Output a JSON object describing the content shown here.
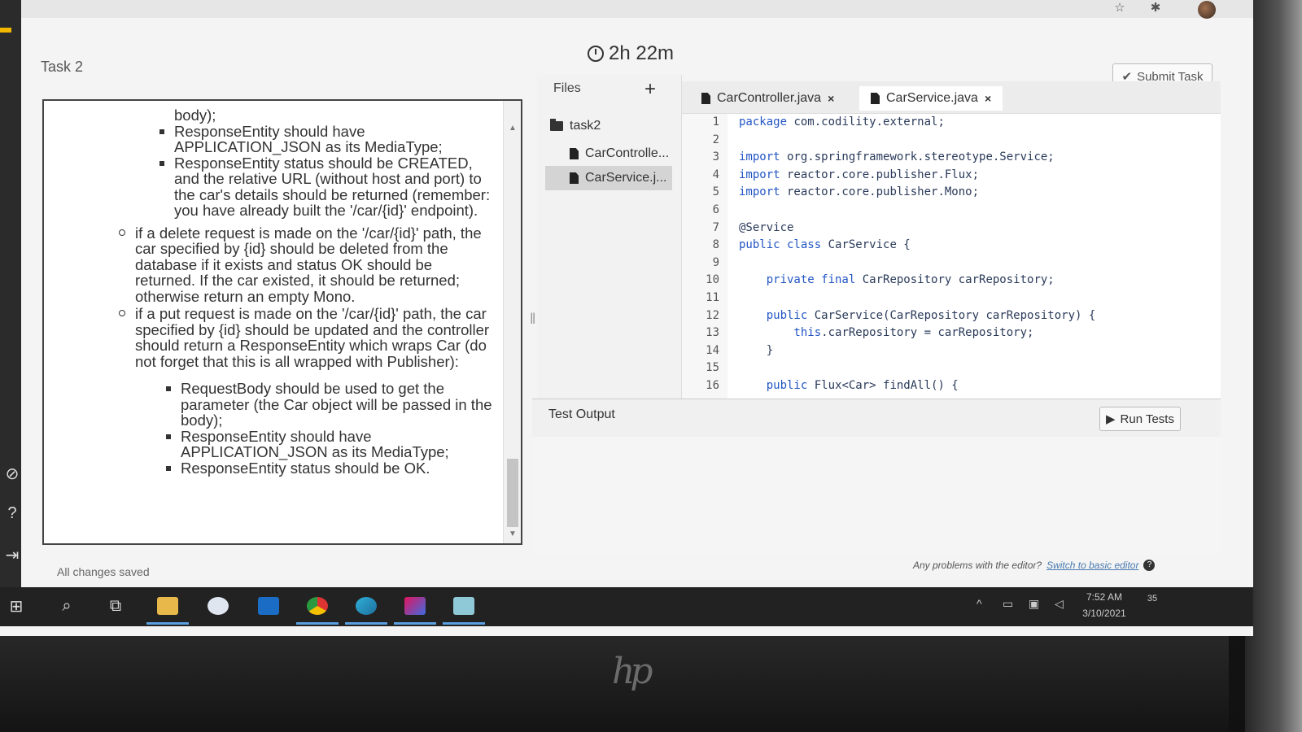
{
  "task_title": "Task 2",
  "timer": "2h 22m",
  "submit_label": "Submit Task",
  "instructions": {
    "cont_text": "body);",
    "group1_bullets": [
      "ResponseEntity should have APPLICATION_JSON as its MediaType;",
      "ResponseEntity status should be CREATED, and the relative URL (without host and port) to the car's details should be returned (remember: you have already built the '/car/{id}' endpoint)."
    ],
    "delete_item": "if a delete request is made on the '/car/{id}' path, the car specified by {id} should be deleted from the database if it exists and status OK should be returned. If the car existed, it should be returned; otherwise return an empty Mono.",
    "put_item": "if a put request is made on the '/car/{id}' path, the car specified by {id} should be updated and the controller should return a ResponseEntity which wraps Car (do not forget that this is all wrapped with Publisher):",
    "put_bullets": [
      "RequestBody should be used to get the parameter (the Car object will be passed in the body);",
      "ResponseEntity should have APPLICATION_JSON as its MediaType;",
      "ResponseEntity status should be OK."
    ]
  },
  "status": "All changes saved",
  "files": {
    "header": "Files",
    "add_symbol": "+",
    "folder": "task2",
    "items": [
      "CarControlle...",
      "CarService.j..."
    ],
    "selected_index": 1
  },
  "tabs": [
    {
      "label": "CarController.java",
      "active": false
    },
    {
      "label": "CarService.java",
      "active": true
    }
  ],
  "code_lines": [
    {
      "n": "1",
      "kw": "package",
      "rest": " com.codility.external;"
    },
    {
      "n": "2",
      "kw": "",
      "rest": ""
    },
    {
      "n": "3",
      "kw": "import",
      "rest": " org.springframework.stereotype.Service;"
    },
    {
      "n": "4",
      "kw": "import",
      "rest": " reactor.core.publisher.Flux;"
    },
    {
      "n": "5",
      "kw": "import",
      "rest": " reactor.core.publisher.Mono;"
    },
    {
      "n": "6",
      "kw": "",
      "rest": ""
    },
    {
      "n": "7",
      "kw": "",
      "rest": "@Service"
    },
    {
      "n": "8",
      "kw": "public class",
      "rest": " CarService {"
    },
    {
      "n": "9",
      "kw": "",
      "rest": ""
    },
    {
      "n": "10",
      "kw": "    private final",
      "rest": " CarRepository carRepository;"
    },
    {
      "n": "11",
      "kw": "",
      "rest": ""
    },
    {
      "n": "12",
      "kw": "    public",
      "rest": " CarService(CarRepository carRepository) {"
    },
    {
      "n": "13",
      "kw": "        this",
      "rest": ".carRepository = carRepository;"
    },
    {
      "n": "14",
      "kw": "",
      "rest": "    }"
    },
    {
      "n": "15",
      "kw": "",
      "rest": ""
    },
    {
      "n": "16",
      "kw": "    public",
      "rest": " Flux<Car> findAll() {"
    }
  ],
  "test_output_label": "Test Output",
  "run_tests_label": "Run Tests",
  "editor_help": {
    "text": "Any problems with the editor?",
    "link": "Switch to basic editor"
  },
  "taskbar": {
    "time": "7:52 AM",
    "date": "3/10/2021",
    "notifications": "35"
  },
  "icons": {
    "star": "star-icon",
    "extensions": "puzzle-icon",
    "menu": "kebab-menu-icon"
  },
  "colors": {
    "keyword": "#2255c4",
    "accent_taskbar": "#5aa0e0"
  }
}
